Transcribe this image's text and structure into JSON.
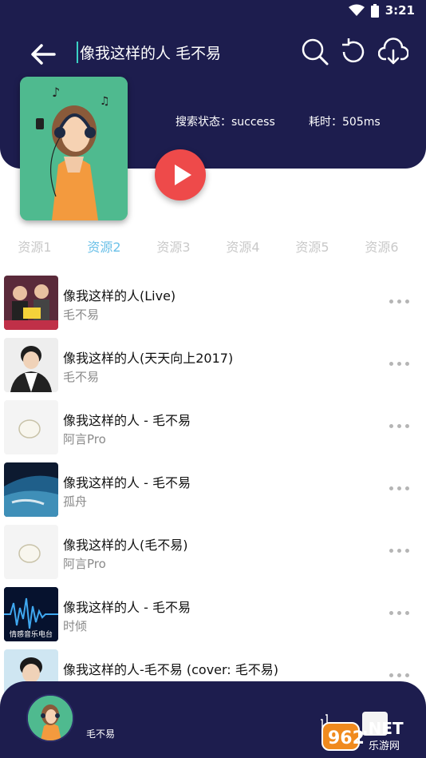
{
  "status_bar": {
    "time": "3:21",
    "icons": [
      "wifi-icon",
      "battery-icon"
    ]
  },
  "header": {
    "search_text": "像我这样的人 毛不易",
    "search_status": "搜索状态：success",
    "elapsed": "耗时：505ms",
    "icons": [
      "back-arrow-icon",
      "search-icon",
      "refresh-icon",
      "download-icon"
    ]
  },
  "tabs": [
    {
      "label": "资源1",
      "active": false
    },
    {
      "label": "资源2",
      "active": true
    },
    {
      "label": "资源3",
      "active": false
    },
    {
      "label": "资源4",
      "active": false
    },
    {
      "label": "资源5",
      "active": false
    },
    {
      "label": "资源6",
      "active": false
    }
  ],
  "songs": [
    {
      "title": "像我这样的人(Live)",
      "artist": "毛不易",
      "thumb": "stage-photo"
    },
    {
      "title": "像我这样的人(天天向上2017)",
      "artist": "毛不易",
      "thumb": "portrait-photo"
    },
    {
      "title": "像我这样的人 - 毛不易",
      "artist": "阿言Pro",
      "thumb": "disc-placeholder"
    },
    {
      "title": "像我这样的人 - 毛不易",
      "artist": "孤舟",
      "thumb": "earth-photo"
    },
    {
      "title": "像我这样的人(毛不易)",
      "artist": "阿言Pro",
      "thumb": "disc-placeholder"
    },
    {
      "title": "像我这样的人 - 毛不易",
      "artist": "时倾",
      "thumb": "radio-cover",
      "thumb_caption": "情感音乐电台"
    },
    {
      "title": "像我这样的人-毛不易 (cover: 毛不易)",
      "artist": "",
      "thumb": "portrait-photo-2"
    }
  ],
  "player": {
    "artist": "毛不易"
  },
  "watermark": {
    "brand": "962.NET",
    "sub": "乐游网"
  },
  "colors": {
    "navy": "#1d1d4e",
    "accent_red": "#ee4a4a",
    "tab_active": "#6cc1e8",
    "cover_green": "#4fba8f"
  }
}
